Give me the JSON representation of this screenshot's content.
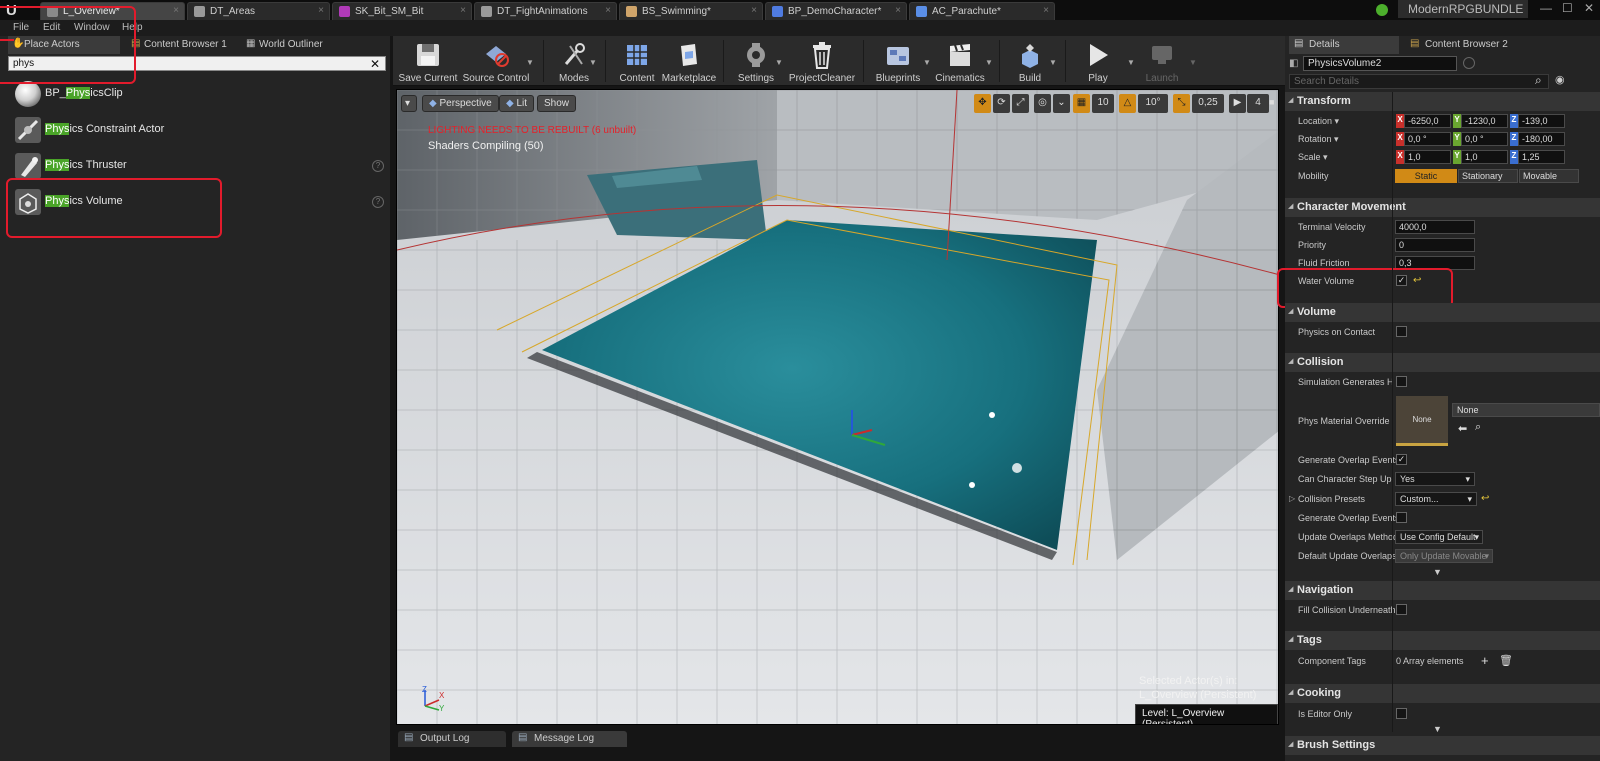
{
  "doc_tabs": [
    {
      "label": "L_Overview*",
      "color": "#8a8a8a"
    },
    {
      "label": "DT_Areas",
      "color": "#9a9a9a"
    },
    {
      "label": "SK_Bit_SM_Bit",
      "color": "#b03ab8"
    },
    {
      "label": "DT_FightAnimations",
      "color": "#9a9a9a"
    },
    {
      "label": "BS_Swimming*",
      "color": "#cfa46a"
    },
    {
      "label": "BP_DemoCharacter*",
      "color": "#4f7be0"
    },
    {
      "label": "AC_Parachute*",
      "color": "#5a8ee6"
    }
  ],
  "brand": "ModernRPGBUNDLE",
  "menu": [
    "File",
    "Edit",
    "Window",
    "Help"
  ],
  "left_tabs": [
    "Place Actors",
    "Content Browser 1",
    "World Outliner"
  ],
  "search": {
    "value": "phys"
  },
  "actors": [
    {
      "pre": "BP_",
      "hl": "Phys",
      "post": "icsClip",
      "icon": "sphere-icon"
    },
    {
      "pre": "",
      "hl": "Phys",
      "post": "ics Constraint Actor",
      "icon": "constraint-icon"
    },
    {
      "pre": "",
      "hl": "Phys",
      "post": "ics Thruster",
      "icon": "thruster-icon"
    },
    {
      "pre": "",
      "hl": "Phys",
      "post": "ics Volume",
      "icon": "volume-icon"
    }
  ],
  "toolbar": {
    "save": "Save Current",
    "source": "Source Control",
    "modes": "Modes",
    "content": "Content",
    "marketplace": "Marketplace",
    "settings": "Settings",
    "cleaner": "ProjectCleaner",
    "blueprints": "Blueprints",
    "cinematics": "Cinematics",
    "build": "Build",
    "play": "Play",
    "launch": "Launch"
  },
  "viewport": {
    "perspective": "Perspective",
    "lit": "Lit",
    "show": "Show",
    "grid_snap": "10",
    "rot_snap": "10°",
    "scale_snap": "0,25",
    "cam_speed": "4",
    "lighting_warning": "LIGHTING NEEDS TO BE REBUILT (6 unbuilt)",
    "shaders": "Shaders Compiling (50)",
    "selected_line1": "Selected Actor(s) in:",
    "selected_line2": "L_Overview (Persistent)",
    "level": "Level:  L_Overview (Persistent)"
  },
  "bottom_tabs": [
    "Output Log",
    "Message Log"
  ],
  "details": {
    "tabs": [
      "Details",
      "Content Browser 2"
    ],
    "name": "PhysicsVolume2",
    "search_placeholder": "Search Details",
    "transform": {
      "title": "Transform",
      "location_label": "Location ▾",
      "location": [
        "-6250,0",
        "-1230,0",
        "-139,0"
      ],
      "rotation_label": "Rotation ▾",
      "rotation": [
        "-180,00",
        "0,0 °",
        "0,0 °"
      ],
      "scale_label": "Scale ▾",
      "scale": [
        "1,0",
        "1,0",
        "1,25"
      ],
      "mobility_label": "Mobility",
      "mobility": [
        "Static",
        "Stationary",
        "Movable"
      ]
    },
    "char_movement": {
      "title": "Character Movement",
      "terminal_velocity_label": "Terminal Velocity",
      "terminal_velocity": "4000,0",
      "priority_label": "Priority",
      "priority": "0",
      "fluid_friction_label": "Fluid Friction",
      "fluid_friction": "0,3",
      "water_volume_label": "Water Volume",
      "water_volume": true
    },
    "volume": {
      "title": "Volume",
      "physics_on_contact_label": "Physics on Contact"
    },
    "collision": {
      "title": "Collision",
      "sim_hit_label": "Simulation Generates Hit Events",
      "phys_mat_label": "Phys Material Override",
      "phys_mat_thumb": "None",
      "phys_mat_value": "None",
      "gen_overlap_label": "Generate Overlap Events",
      "step_up_label": "Can Character Step Up On",
      "step_up": "Yes",
      "presets_label": "Collision Presets",
      "presets": "Custom...",
      "gen_overlap2_label": "Generate Overlap Events",
      "update_method_label": "Update Overlaps Method",
      "update_method": "Use Config Default",
      "default_update_label": "Default Update Overlaps",
      "default_update": "Only Update Movable"
    },
    "navigation": {
      "title": "Navigation",
      "fill_label": "Fill Collision Underneath"
    },
    "tags": {
      "title": "Tags",
      "component_tags_label": "Component Tags",
      "component_tags": "0 Array elements"
    },
    "cooking": {
      "title": "Cooking",
      "editor_only_label": "Is Editor Only"
    },
    "brush": {
      "title": "Brush Settings"
    }
  },
  "colors": {
    "accent_orange": "#d18a16",
    "highlight_green": "#4aa428",
    "annotation_red": "#e21b2c",
    "water": "#1f7f8c"
  }
}
